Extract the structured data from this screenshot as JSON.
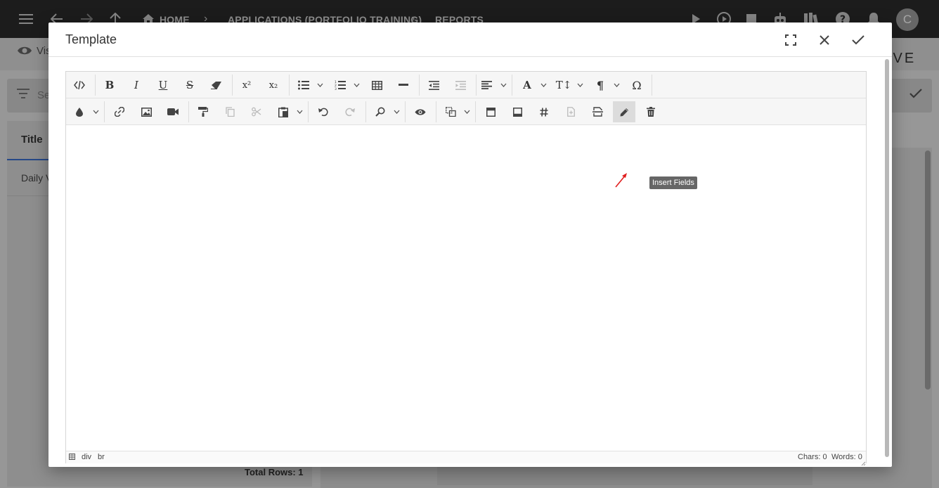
{
  "topbar": {
    "breadcrumbs": [
      "HOME",
      "APPLICATIONS (PORTFOLIO TRAINING)",
      "REPORTS"
    ],
    "avatar_initial": "C"
  },
  "background": {
    "view_label": "Vis",
    "brand_fragment": "IVE",
    "search_placeholder": "Se",
    "column_title": "Title",
    "row_title": "Daily V",
    "total_rows": "Total Rows: 1"
  },
  "modal": {
    "title": "Template"
  },
  "toolbar": {
    "superscript_label": "x²",
    "subscript_label": "x₂",
    "font_label": "A",
    "font_size_label": "T↕",
    "paragraph_label": "¶",
    "special_chars_label": "Ω",
    "bold_label": "B",
    "italic_label": "I",
    "underline_label": "U",
    "strike_label": "S",
    "tooltip": "Insert Fields"
  },
  "statusbar": {
    "path": [
      "div",
      "br"
    ],
    "chars": "Chars: 0",
    "words": "Words: 0"
  },
  "colors": {
    "topbar": "#2b2b2b",
    "accent": "#3b6fd0",
    "arrow": "#e02020"
  }
}
